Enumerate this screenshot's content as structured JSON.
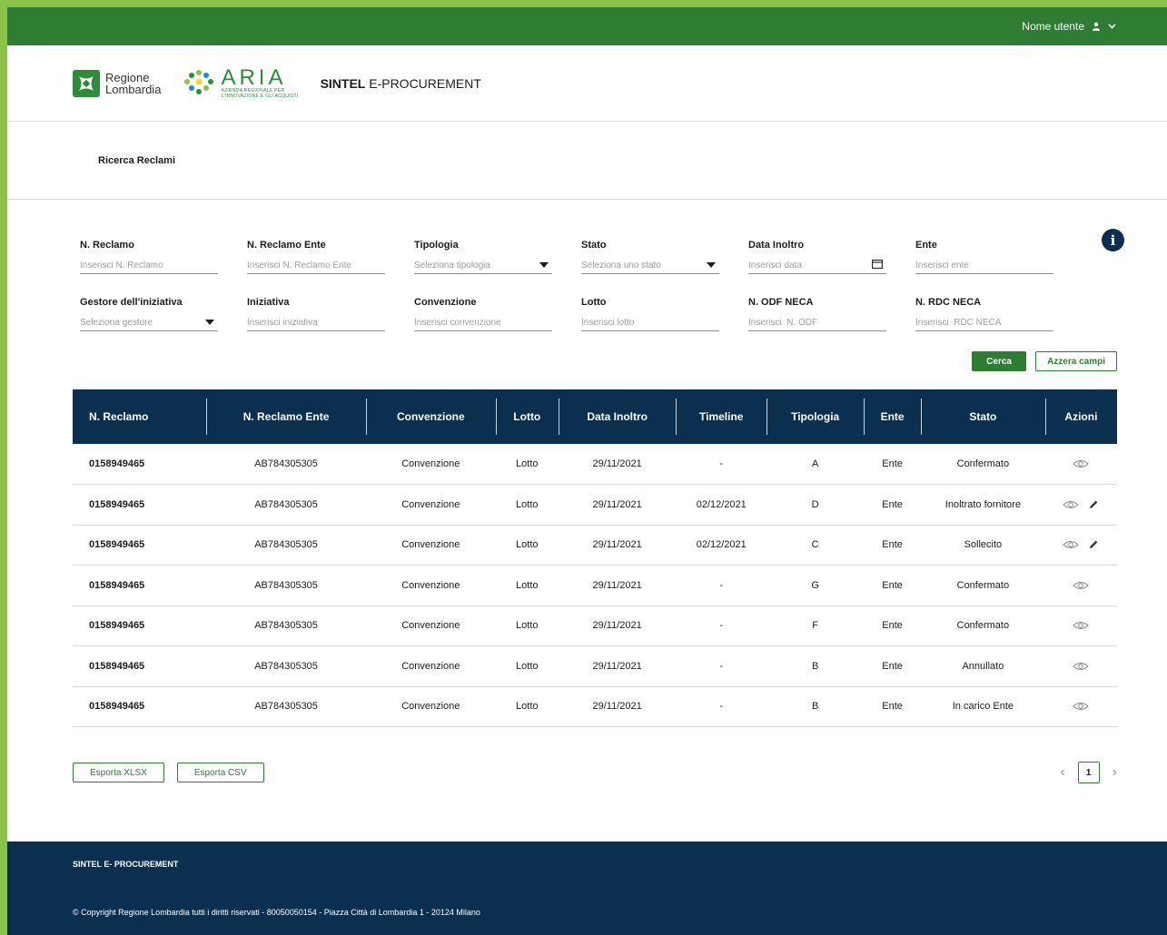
{
  "topbar": {
    "user_label": "Nome utente",
    "user_icon": "user-icon"
  },
  "brand": {
    "rl_line1": "Regione",
    "rl_line2": "Lombardia",
    "aria_name": "ARIA",
    "aria_sub1": "AZIENDA REGIONALE PER",
    "aria_sub2": "L'INNOVAZIONE E GLI ACQUISTI",
    "app_bold": "SINTEL",
    "app_rest": " E-PROCUREMENT"
  },
  "page": {
    "title": "Ricerca Reclami"
  },
  "filters": {
    "n_reclamo": {
      "label": "N. Reclamo",
      "placeholder": "Inserisci N. Reclamo"
    },
    "n_reclamo_ente": {
      "label": "N. Reclamo Ente",
      "placeholder": "Inserisci N. Reclamo Ente"
    },
    "tipologia": {
      "label": "Tipologia",
      "placeholder": "Seleziona tipologia"
    },
    "stato": {
      "label": "Stato",
      "placeholder": "Seleziona uno stato"
    },
    "data_inoltro": {
      "label": "Data Inoltro",
      "placeholder": "Inserisci data"
    },
    "ente": {
      "label": "Ente",
      "placeholder": "Inserisci ente"
    },
    "gestore": {
      "label": "Gestore dell'iniziativa",
      "placeholder": "Seleziona gestore"
    },
    "iniziativa": {
      "label": "Iniziativa",
      "placeholder": "Inserisci iniziativa"
    },
    "convenzione": {
      "label": "Convenzione",
      "placeholder": "Inserisci convenzione"
    },
    "lotto": {
      "label": "Lotto",
      "placeholder": "Inserisci lotto"
    },
    "odf": {
      "label": "N. ODF NECA",
      "placeholder": "Inserisci  N. ODF"
    },
    "rdc": {
      "label": "N. RDC NECA",
      "placeholder": "Inserisci  RDC NECA"
    }
  },
  "buttons": {
    "search": "Cerca",
    "reset": "Azzera campi",
    "export_xlsx": "Esporta XLSX",
    "export_csv": "Esporta CSV"
  },
  "table": {
    "headers": [
      "N. Reclamo",
      "N. Reclamo Ente",
      "Convenzione",
      "Lotto",
      "Data Inoltro",
      "Timeline",
      "Tipologia",
      "Ente",
      "Stato",
      "Azioni"
    ],
    "rows": [
      {
        "n": "0158949465",
        "ente_n": "AB784305305",
        "conv": "Convenzione",
        "lotto": "Lotto",
        "data": "29/11/2021",
        "timeline": "-",
        "tipo": "A",
        "ente": "Ente",
        "stato": "Confermato",
        "edit": false
      },
      {
        "n": "0158949465",
        "ente_n": "AB784305305",
        "conv": "Convenzione",
        "lotto": "Lotto",
        "data": "29/11/2021",
        "timeline": "02/12/2021",
        "tipo": "D",
        "ente": "Ente",
        "stato": "Inoltrato fornitore",
        "edit": true
      },
      {
        "n": "0158949465",
        "ente_n": "AB784305305",
        "conv": "Convenzione",
        "lotto": "Lotto",
        "data": "29/11/2021",
        "timeline": "02/12/2021",
        "tipo": "C",
        "ente": "Ente",
        "stato": "Sollecito",
        "edit": true
      },
      {
        "n": "0158949465",
        "ente_n": "AB784305305",
        "conv": "Convenzione",
        "lotto": "Lotto",
        "data": "29/11/2021",
        "timeline": "-",
        "tipo": "G",
        "ente": "Ente",
        "stato": "Confermato",
        "edit": false
      },
      {
        "n": "0158949465",
        "ente_n": "AB784305305",
        "conv": "Convenzione",
        "lotto": "Lotto",
        "data": "29/11/2021",
        "timeline": "-",
        "tipo": "F",
        "ente": "Ente",
        "stato": "Confermato",
        "edit": false
      },
      {
        "n": "0158949465",
        "ente_n": "AB784305305",
        "conv": "Convenzione",
        "lotto": "Lotto",
        "data": "29/11/2021",
        "timeline": "-",
        "tipo": "B",
        "ente": "Ente",
        "stato": "Annullato",
        "edit": false
      },
      {
        "n": "0158949465",
        "ente_n": "AB784305305",
        "conv": "Convenzione",
        "lotto": "Lotto",
        "data": "29/11/2021",
        "timeline": "-",
        "tipo": "B",
        "ente": "Ente",
        "stato": "In carico Ente",
        "edit": false
      }
    ]
  },
  "pager": {
    "current": "1",
    "prev": "‹",
    "next": "›"
  },
  "footer": {
    "title": "SINTEL E- PROCUREMENT",
    "copyright": "© Copyright Regione Lombardia tutti i diritti riservati - 80050050154 - Piazza Città di Lombardia 1 - 20124 Milano"
  },
  "colors": {
    "topbar": "#2e7d32",
    "frame": "#8bc34a",
    "navy": "#0b2f4f"
  },
  "icons": {
    "view": "eye-icon",
    "edit": "pencil-icon",
    "info": "info-icon",
    "calendar": "calendar-icon",
    "dropdown": "caret-down-icon"
  }
}
